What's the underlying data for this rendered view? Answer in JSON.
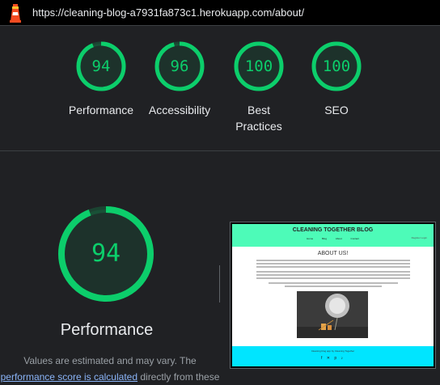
{
  "url_bar": {
    "url": "https://cleaning-blog-a7931fa873c1.herokuapp.com/about/"
  },
  "scores": [
    {
      "value": "94",
      "label": "Performance"
    },
    {
      "value": "96",
      "label": "Accessibility"
    },
    {
      "value": "100",
      "label": "Best Practices"
    },
    {
      "value": "100",
      "label": "SEO"
    }
  ],
  "performance": {
    "score": "94",
    "score_fraction": 0.94,
    "title": "Performance",
    "note_line1": "Values are estimated and may vary. The",
    "note_link": "performance score is calculated",
    "note_line2_rest": " directly from these"
  },
  "colors": {
    "pass": "#0cce6b",
    "background": "#202124",
    "link": "#8ab4f8"
  },
  "screenshot": {
    "brand": "CLEANING TOGETHER BLOG",
    "nav_links": [
      "Home",
      "Blog",
      "About",
      "Contact"
    ],
    "register": "Register Login",
    "heading": "ABOUT US!",
    "footer_text": "Cleaning blog app by Cleaning Together"
  }
}
